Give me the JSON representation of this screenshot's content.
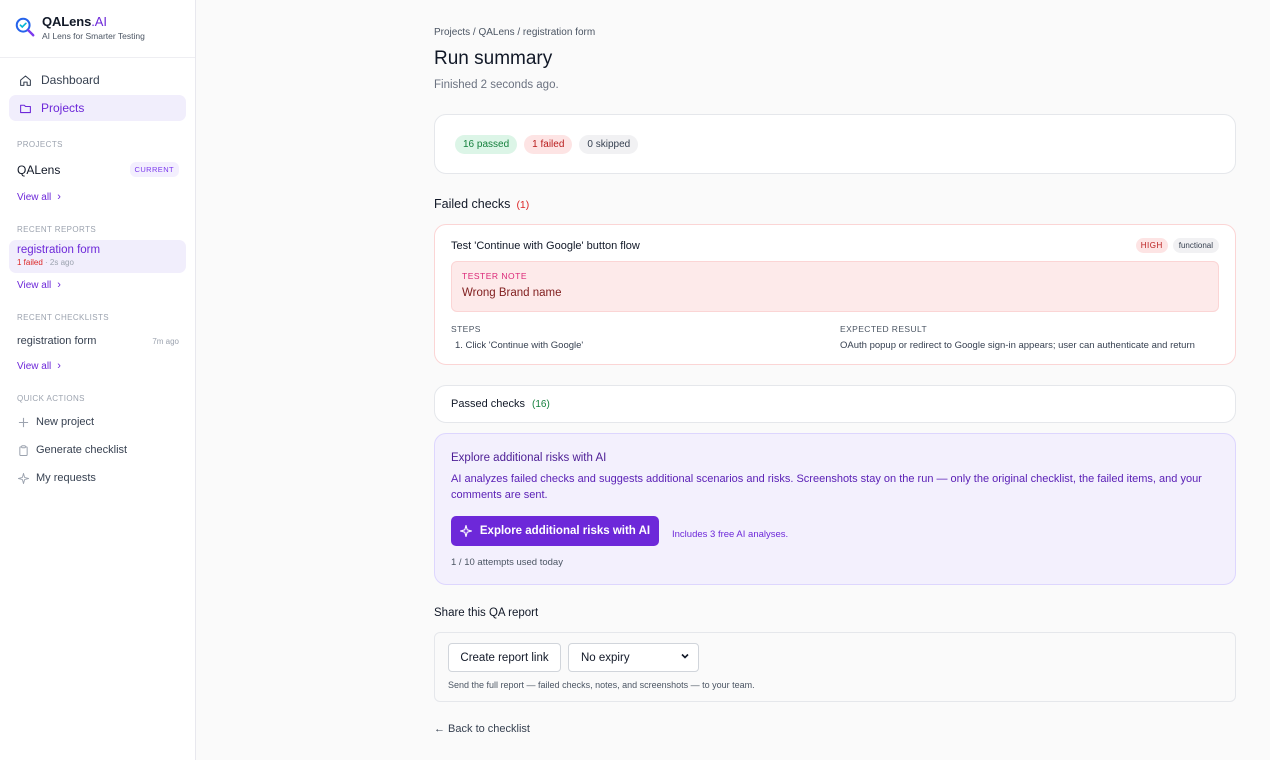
{
  "brand": {
    "name": "QALens",
    "suffix": ".AI",
    "tagline": "AI Lens for Smarter Testing"
  },
  "nav": {
    "dashboard": "Dashboard",
    "projects": "Projects"
  },
  "sidebar": {
    "projects_label": "PROJECTS",
    "project_name": "QALens",
    "current_badge": "CURRENT",
    "view_all": "View all",
    "recent_reports_label": "RECENT REPORTS",
    "report": {
      "title": "registration form",
      "failed": "1 failed",
      "meta_rest": " · 2s ago"
    },
    "recent_checklists_label": "RECENT CHECKLISTS",
    "checklist": {
      "name": "registration form",
      "time": "7m ago"
    },
    "quick_actions_label": "QUICK ACTIONS",
    "quick_actions": {
      "new_project": "New project",
      "generate_checklist": "Generate checklist",
      "my_requests": "My requests"
    }
  },
  "main": {
    "breadcrumb": "Projects / QALens / registration form",
    "title": "Run summary",
    "subtitle": "Finished 2 seconds ago.",
    "stats": {
      "passed": "16 passed",
      "failed": "1 failed",
      "skipped": "0 skipped"
    },
    "failed_section": {
      "heading": "Failed checks",
      "count": "(1)"
    },
    "failed_check": {
      "title": "Test 'Continue with Google' button flow",
      "severity": "HIGH",
      "category": "functional",
      "note_label": "TESTER NOTE",
      "note_text": "Wrong Brand name",
      "steps_label": "STEPS",
      "step_1": "1. Click 'Continue with Google'",
      "expected_label": "EXPECTED RESULT",
      "expected_text": "OAuth popup or redirect to Google sign-in appears; user can authenticate and return"
    },
    "passed_section": {
      "heading": "Passed checks",
      "count": "(16)"
    },
    "ai": {
      "title": "Explore additional risks with AI",
      "description": "AI analyzes failed checks and suggests additional scenarios and risks. Screenshots stay on the run — only the original checklist, the failed items, and your comments are sent.",
      "button": "Explore additional risks with AI",
      "free_note": "Includes 3 free AI analyses.",
      "attempts": "1 / 10 attempts used today"
    },
    "share": {
      "heading": "Share this QA report",
      "button": "Create report link",
      "expiry_selected": "No expiry",
      "help": "Send the full report — failed checks, notes, and screenshots — to your team."
    },
    "back_link": "← Back to checklist"
  },
  "colors": {
    "accent": "#6d28d9",
    "pass": "#15803d",
    "fail": "#dc2626"
  }
}
